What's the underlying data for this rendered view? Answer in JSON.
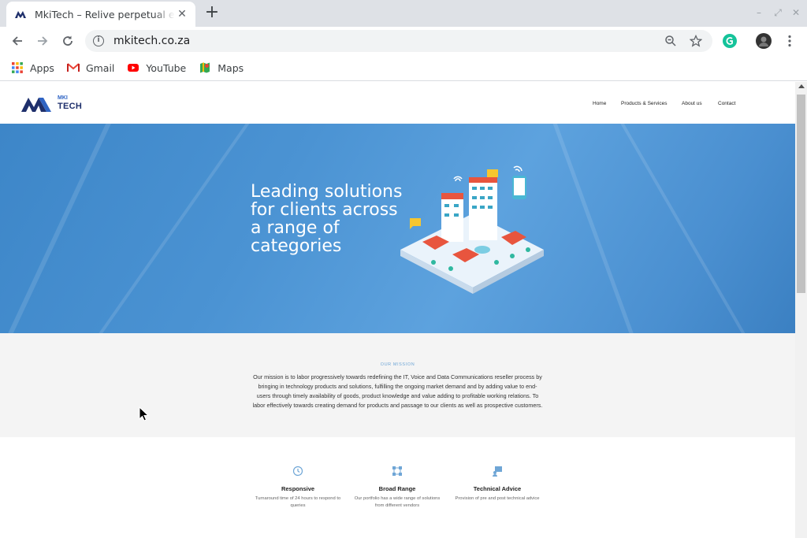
{
  "browser": {
    "tab_title": "MkiTech – Relive perpetual excellence",
    "new_tab_symbol": "+",
    "tab_close_symbol": "✕",
    "url": "mkitech.co.za",
    "window_controls": [
      "–",
      "⤢",
      "✕"
    ],
    "bookmarks": [
      {
        "label": "Apps",
        "icon": "apps-grid-icon"
      },
      {
        "label": "Gmail",
        "icon": "gmail-icon"
      },
      {
        "label": "YouTube",
        "icon": "youtube-icon"
      },
      {
        "label": "Maps",
        "icon": "maps-icon"
      }
    ]
  },
  "site": {
    "logo": {
      "top": "MKI",
      "bottom": "TECH"
    },
    "nav": [
      "Home",
      "Products & Services",
      "About us",
      "Contact"
    ],
    "hero_title": "Leading solutions for clients across a range of categories",
    "mission_label": "OUR MISSION",
    "mission_text": "Our mission is to labor progressively towards redefining the IT, Voice and Data Communications reseller process by bringing in technology products and solutions, fulfilling the ongoing market demand and by adding value to end-users through timely availability of goods, product knowledge and value adding to profitable working relations. To labor effectively towards creating demand for products and passage to our clients as well as prospective customers.",
    "features": [
      {
        "icon": "clock-icon",
        "title": "Responsive",
        "desc": "Turnaround time of 24 hours to respond to queries"
      },
      {
        "icon": "network-icon",
        "title": "Broad Range",
        "desc": "Our portfolio has a wide range of solutions from different vendors"
      },
      {
        "icon": "support-icon",
        "title": "Technical Advice",
        "desc": "Provision of pre and post technical advice"
      }
    ]
  },
  "colors": {
    "accent": "#4a90d2",
    "logo_dark": "#1e2f6b",
    "icon_blue": "#6fa6d6"
  }
}
